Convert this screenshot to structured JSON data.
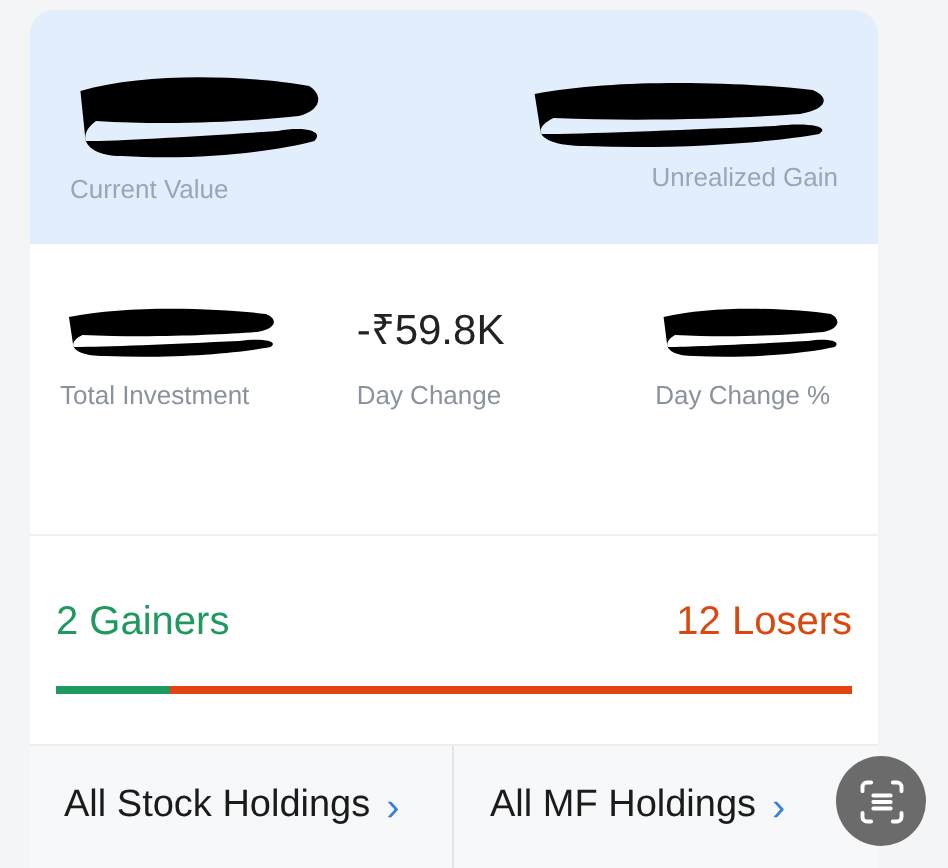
{
  "summary": {
    "current_value_label": "Current Value",
    "unrealized_gain_label": "Unrealized Gain"
  },
  "stats": [
    {
      "label": "Total Investment",
      "redacted": true
    },
    {
      "label": "Day Change",
      "redacted": false,
      "value": "-₹59.8K"
    },
    {
      "label": "Day Change %",
      "redacted": true
    }
  ],
  "movers": {
    "gainers": "2 Gainers",
    "losers": "12 Losers",
    "level": 0.143
  },
  "links": [
    {
      "label": "All Stock Holdings",
      "chevron": "›"
    },
    {
      "label": "All MF Holdings",
      "chevron": "›"
    }
  ]
}
